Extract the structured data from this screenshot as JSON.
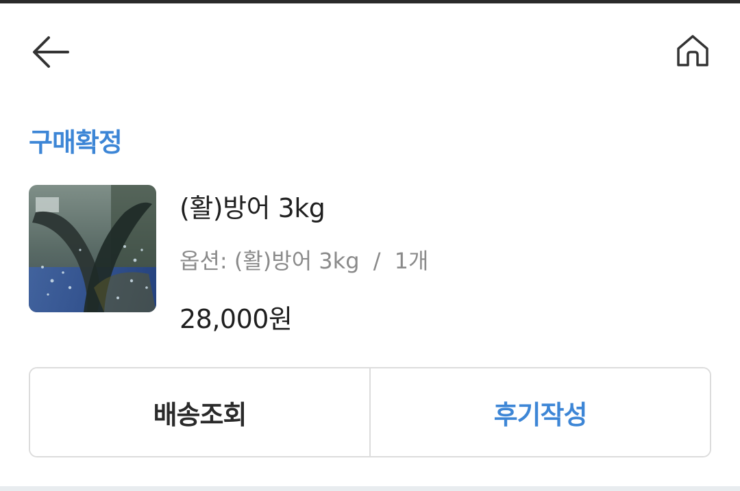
{
  "nav": {
    "back_icon": "arrow-left-icon",
    "home_icon": "home-icon"
  },
  "order": {
    "status": "구매확정",
    "status_color": "#3d86d6",
    "product": {
      "name": "(활)방어 3kg",
      "option_label": "옵션:",
      "option_value": "(활)방어 3kg",
      "quantity": "1개",
      "price": "28,000원"
    }
  },
  "actions": {
    "track_label": "배송조회",
    "review_label": "후기작성",
    "review_color": "#3d86d6"
  }
}
